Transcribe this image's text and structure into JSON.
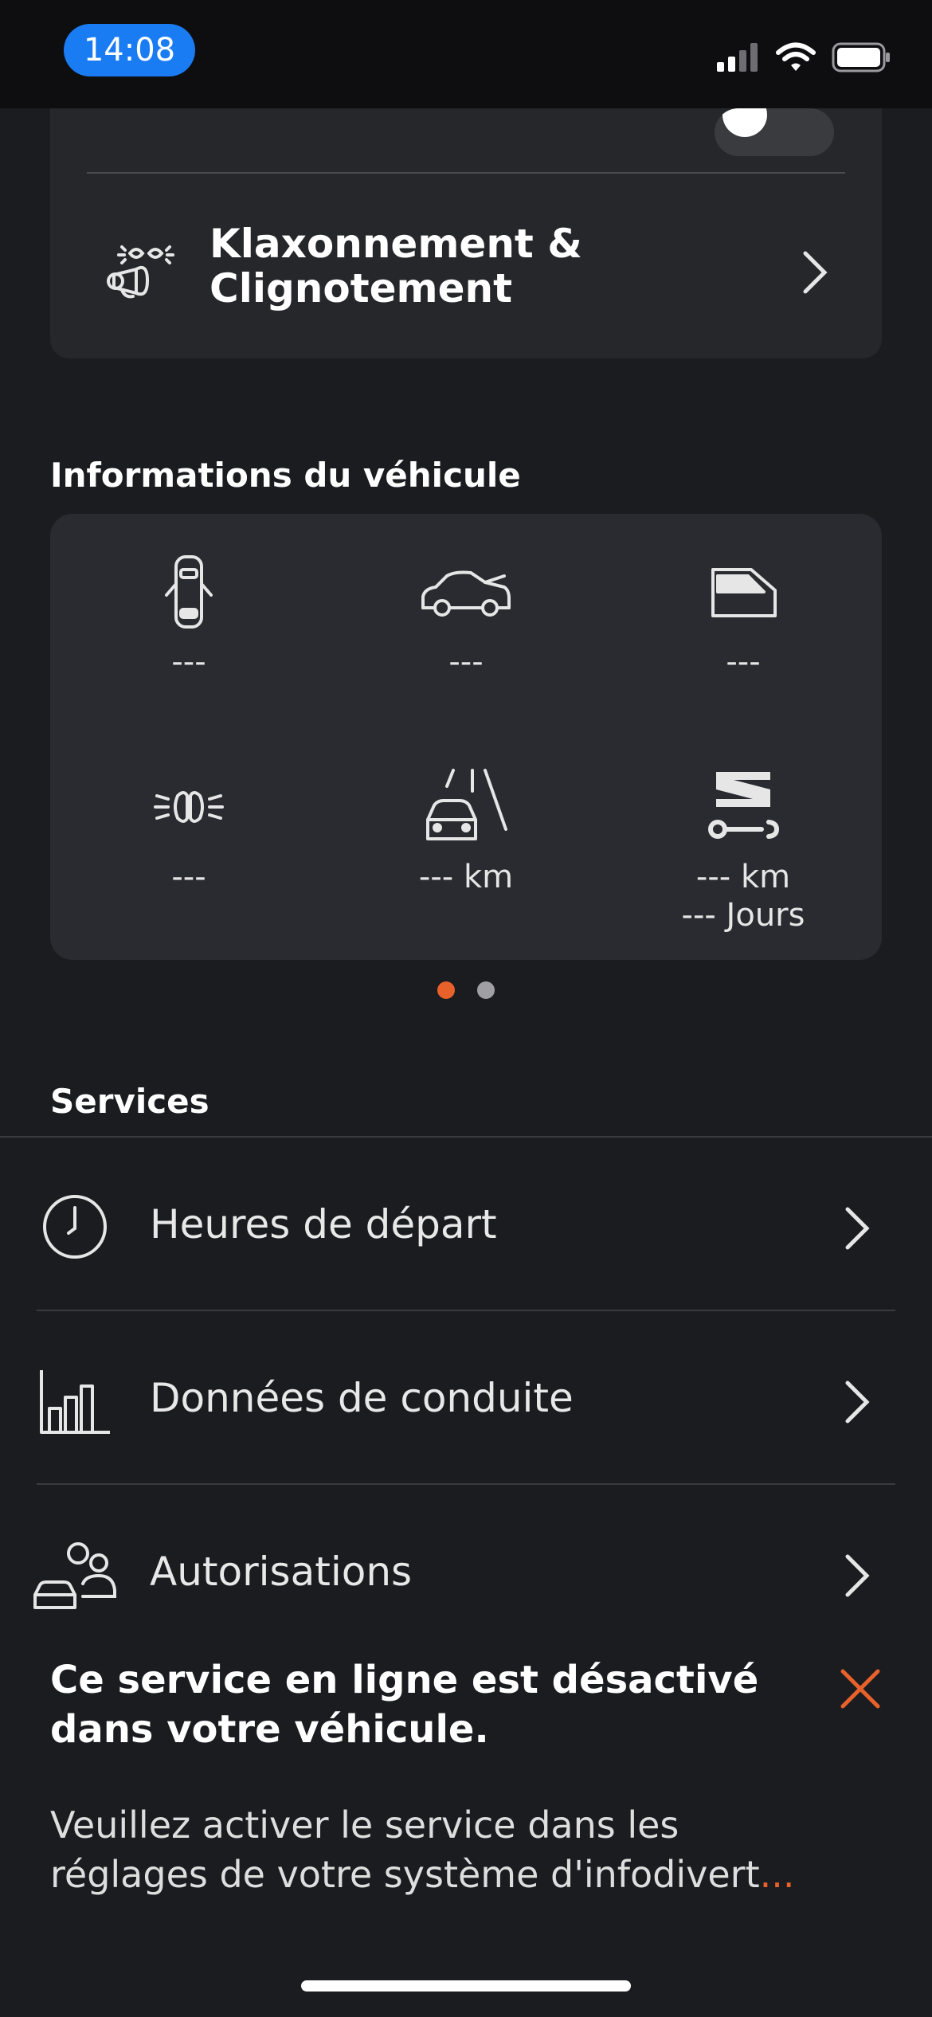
{
  "status_bar": {
    "time": "14:08"
  },
  "top_card": {
    "horn_label": "Klaxonnement & Clignotement"
  },
  "vehicle_info": {
    "title": "Informations du véhicule",
    "items": [
      {
        "icon": "car-doors-icon",
        "value": "---"
      },
      {
        "icon": "car-trunk-icon",
        "value": "---"
      },
      {
        "icon": "car-window-icon",
        "value": "---"
      },
      {
        "icon": "headlights-icon",
        "value": "---"
      },
      {
        "icon": "car-road-icon",
        "value": "--- km"
      },
      {
        "icon": "seat-service-icon",
        "value": "--- km\n--- Jours"
      }
    ],
    "pager": {
      "pages": 2,
      "active": 0
    }
  },
  "services": {
    "title": "Services",
    "items": [
      {
        "icon": "clock-icon",
        "label": "Heures de départ"
      },
      {
        "icon": "bar-chart-icon",
        "label": "Données de conduite"
      },
      {
        "icon": "authorizations-icon",
        "label": "Autorisations"
      }
    ]
  },
  "notice": {
    "title": "Ce service en ligne est désactivé dans votre véhicule.",
    "body": "Veuillez activer le service dans les réglages de votre système d'infodivert",
    "more": "..."
  },
  "colors": {
    "accent": "#e8602a",
    "time_pill": "#1a7cf2",
    "background": "#1b1c20",
    "card": "#2a2b30"
  }
}
